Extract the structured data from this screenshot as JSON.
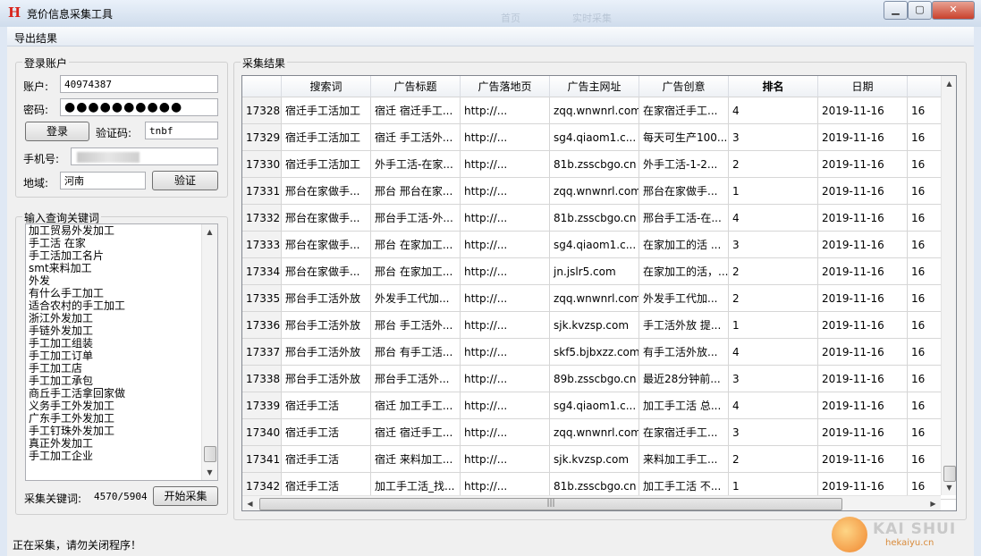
{
  "window": {
    "title": "竞价信息采集工具",
    "ghost_tab_1": "首页",
    "ghost_tab_2": "实时采集"
  },
  "menu": {
    "export_results": "导出结果"
  },
  "login": {
    "group_title": "登录账户",
    "account_label": "账户:",
    "account_value": "40974387",
    "password_label": "密码:",
    "password_value": "●●●●●●●●●●",
    "login_button": "登录",
    "captcha_label": "验证码:",
    "captcha_value": "tnbf",
    "phone_label": "手机号:",
    "region_label": "地域:",
    "region_value": "河南",
    "verify_button": "验证"
  },
  "keywords": {
    "group_title": "输入查询关键词",
    "items": [
      "加工贸易外发加工",
      "手工活 在家",
      "手工活加工名片",
      "smt来料加工",
      "外发",
      "有什么手工加工",
      "适合农村的手工加工",
      "浙江外发加工",
      "手链外发加工",
      "手工加工组装",
      "手工加工订单",
      "手工加工店",
      "手工加工承包",
      "商丘手工活拿回家做",
      "义务手工外发加工",
      "广东手工外发加工",
      "手工钉珠外发加工",
      "真正外发加工",
      "手工加工企业"
    ],
    "progress_label": "采集关键词:",
    "progress_value": "4570/5904",
    "start_button": "开始采集"
  },
  "results": {
    "group_title": "采集结果",
    "columns": [
      "",
      "搜索词",
      "广告标题",
      "广告落地页",
      "广告主网址",
      "广告创意",
      "排名",
      "日期",
      ""
    ],
    "rows": [
      [
        "17328",
        "宿迁手工活加工",
        "宿迁 宿迁手工...",
        "http://...",
        "zqq.wnwnrl.com",
        "在家宿迁手工...",
        "4",
        "2019-11-16",
        "16"
      ],
      [
        "17329",
        "宿迁手工活加工",
        "宿迁 手工活外...",
        "http://...",
        "sg4.qiaom1.c...",
        "每天可生产100...",
        "3",
        "2019-11-16",
        "16"
      ],
      [
        "17330",
        "宿迁手工活加工",
        "外手工活-在家...",
        "http://...",
        "81b.zsscbgo.cn",
        "外手工活-1-2...",
        "2",
        "2019-11-16",
        "16"
      ],
      [
        "17331",
        "邢台在家做手...",
        "邢台 邢台在家...",
        "http://...",
        "zqq.wnwnrl.com",
        "邢台在家做手...",
        "1",
        "2019-11-16",
        "16"
      ],
      [
        "17332",
        "邢台在家做手...",
        "邢台手工活-外...",
        "http://...",
        "81b.zsscbgo.cn",
        "邢台手工活-在...",
        "4",
        "2019-11-16",
        "16"
      ],
      [
        "17333",
        "邢台在家做手...",
        "邢台 在家加工...",
        "http://...",
        "sg4.qiaom1.c...",
        "在家加工的活 ...",
        "3",
        "2019-11-16",
        "16"
      ],
      [
        "17334",
        "邢台在家做手...",
        "邢台 在家加工...",
        "http://...",
        "jn.jslr5.com",
        "在家加工的活，...",
        "2",
        "2019-11-16",
        "16"
      ],
      [
        "17335",
        "邢台手工活外放",
        "外发手工代加...",
        "http://...",
        "zqq.wnwnrl.com",
        "外发手工代加...",
        "2",
        "2019-11-16",
        "16"
      ],
      [
        "17336",
        "邢台手工活外放",
        "邢台 手工活外...",
        "http://...",
        "sjk.kvzsp.com",
        "手工活外放 提...",
        "1",
        "2019-11-16",
        "16"
      ],
      [
        "17337",
        "邢台手工活外放",
        "邢台 有手工活...",
        "http://...",
        "skf5.bjbxzz.com",
        "有手工活外放...",
        "4",
        "2019-11-16",
        "16"
      ],
      [
        "17338",
        "邢台手工活外放",
        "邢台手工活外...",
        "http://...",
        "89b.zsscbgo.cn",
        "最近28分钟前...",
        "3",
        "2019-11-16",
        "16"
      ],
      [
        "17339",
        "宿迁手工活",
        "宿迁 加工手工...",
        "http://...",
        "sg4.qiaom1.c...",
        "加工手工活 总...",
        "4",
        "2019-11-16",
        "16"
      ],
      [
        "17340",
        "宿迁手工活",
        "宿迁 宿迁手工...",
        "http://...",
        "zqq.wnwnrl.com",
        "在家宿迁手工...",
        "3",
        "2019-11-16",
        "16"
      ],
      [
        "17341",
        "宿迁手工活",
        "宿迁 来料加工...",
        "http://...",
        "sjk.kvzsp.com",
        "来料加工手工...",
        "2",
        "2019-11-16",
        "16"
      ],
      [
        "17342",
        "宿迁手工活",
        "加工手工活_找...",
        "http://...",
        "81b.zsscbgo.cn",
        "加工手工活 不...",
        "1",
        "2019-11-16",
        "16"
      ]
    ]
  },
  "status": {
    "text": "正在采集，请勿关闭程序！"
  },
  "watermark": {
    "brand": "KAI SHUI",
    "site": "hekaiyu.cn"
  }
}
